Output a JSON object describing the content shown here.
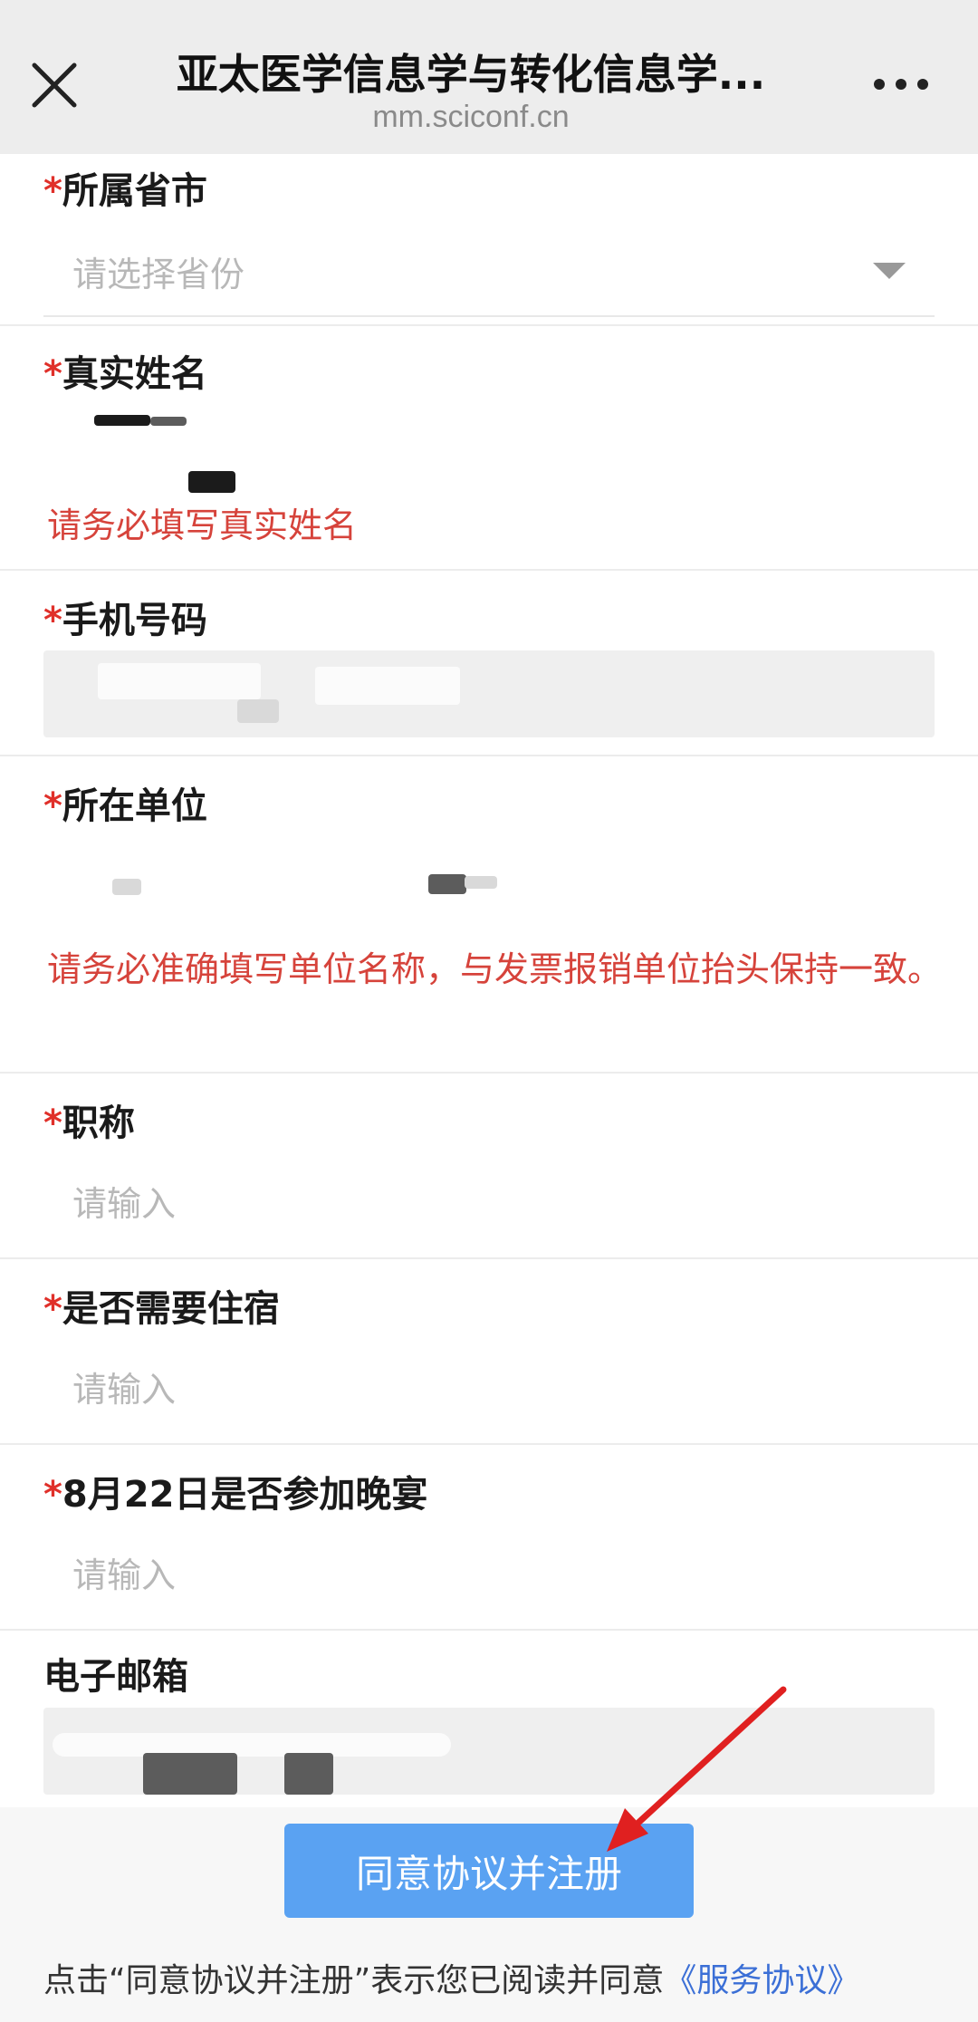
{
  "header": {
    "title": "亚太医学信息学与转化信息学...",
    "url": "mm.sciconf.cn",
    "close_icon": "close-icon",
    "more_icon": "more-dots-icon"
  },
  "form": {
    "province": {
      "required_mark": "*",
      "label": "所属省市",
      "placeholder": "请选择省份"
    },
    "real_name": {
      "required_mark": "*",
      "label": "真实姓名",
      "hint": "请务必填写真实姓名"
    },
    "phone": {
      "required_mark": "*",
      "label": "手机号码"
    },
    "organization": {
      "required_mark": "*",
      "label": "所在单位",
      "hint": "请务必准确填写单位名称，与发票报销单位抬头保持一致。"
    },
    "job_title": {
      "required_mark": "*",
      "label": "职称",
      "placeholder": "请输入"
    },
    "accommodation": {
      "required_mark": "*",
      "label": "是否需要住宿",
      "placeholder": "请输入"
    },
    "banquet": {
      "required_mark": "*",
      "label": "8月22日是否参加晚宴",
      "placeholder": "请输入"
    },
    "email": {
      "label": "电子邮箱"
    }
  },
  "footer": {
    "submit_label": "同意协议并注册",
    "agreement_text": "点击“同意协议并注册”表示您已阅读并同意",
    "agreement_link": "《服务协议》"
  },
  "colors": {
    "accent": "#5aa2f2",
    "required": "#e0302a",
    "hint": "#d6433b",
    "link": "#3b6fd6",
    "annotation_arrow": "#e02020"
  }
}
